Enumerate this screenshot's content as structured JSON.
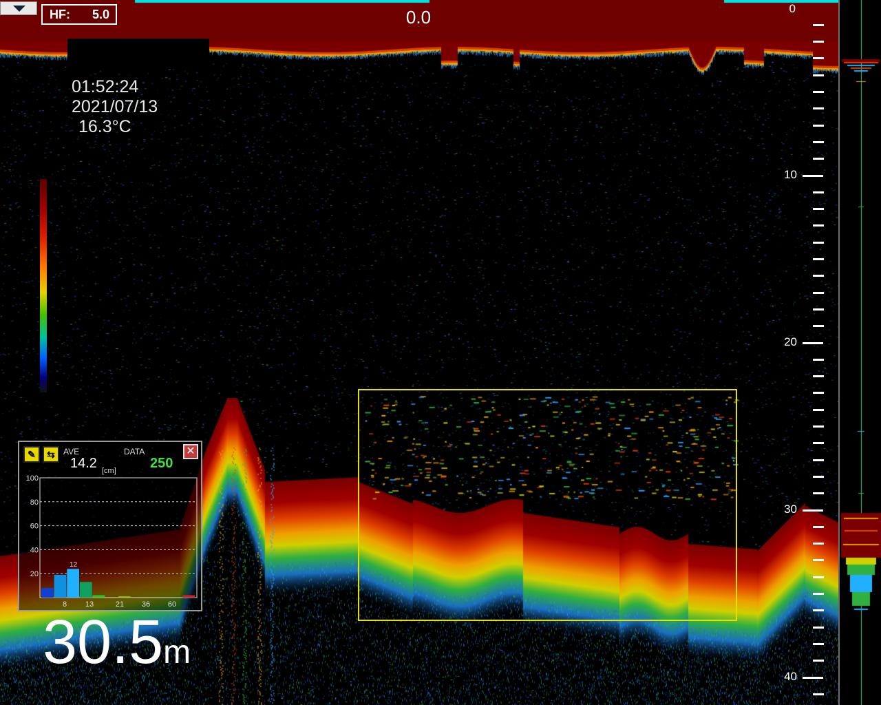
{
  "header": {
    "hf_label": "HF:",
    "hf_value": "5.0",
    "shift_depth": "0.0"
  },
  "info": {
    "time": "01:52:24",
    "date": "2021/07/13",
    "temperature": "16.3°C"
  },
  "scale": {
    "labels": [
      "0",
      "10",
      "20",
      "30",
      "40"
    ]
  },
  "panel": {
    "ave_label": "AVE",
    "ave_value": "14.2",
    "ave_unit": "[cm]",
    "data_label": "DATA",
    "data_value": "250",
    "close_glyph": "✕",
    "tool1_glyph": "✎",
    "tool2_glyph": "⇆",
    "y_labels": [
      "100",
      "80",
      "60",
      "40",
      "20"
    ],
    "x_labels": [
      "8",
      "13",
      "21",
      "36",
      "60"
    ],
    "peak_label": "12",
    "histogram_values": [
      8,
      19,
      24,
      13,
      2,
      0,
      1,
      0,
      0,
      0,
      0,
      2
    ]
  },
  "depth": {
    "value": "30.5",
    "unit": "m"
  },
  "colors": {
    "surface": "#6e0000",
    "bottom": "#7a0000",
    "selection": "#e6e000",
    "accent_green": "#40e040",
    "strip_line": "#3ccf7a"
  }
}
